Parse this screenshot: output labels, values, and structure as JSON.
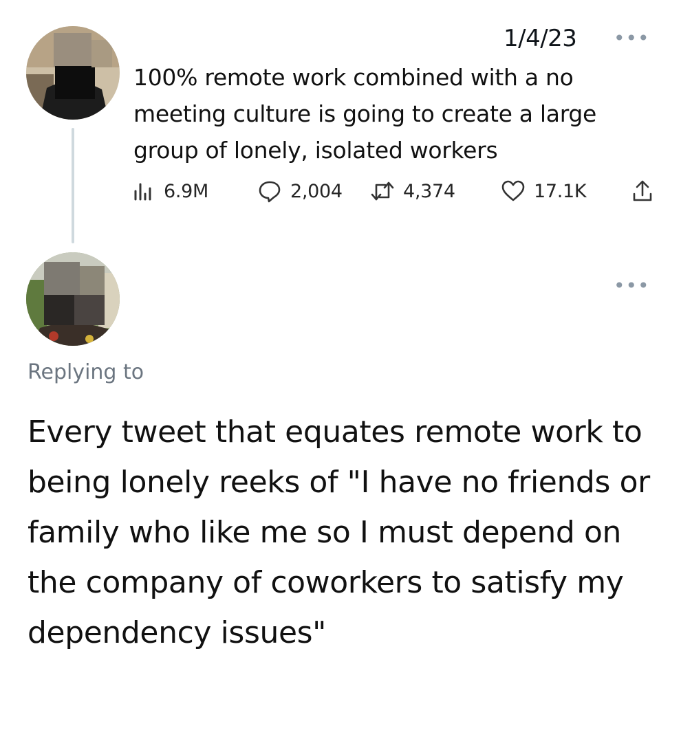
{
  "tweet": {
    "date": "1/4/23",
    "more_icon": "ellipsis-icon",
    "text": "100% remote work combined with a no meeting culture is going to create a large group of lonely, isolated workers",
    "stats": {
      "views": "6.9M",
      "replies": "2,004",
      "retweets": "4,374",
      "likes": "17.1K"
    }
  },
  "reply": {
    "more_icon": "ellipsis-icon",
    "replying_to": "Replying to",
    "text": "Every tweet that equates remote work to being lonely reeks of \"I have no friends or family who like me so I must depend on the company of coworkers to satisfy my dependency issues\""
  },
  "colors": {
    "thread_line": "#cfd9de",
    "muted": "#6b7580",
    "text": "#111111"
  }
}
